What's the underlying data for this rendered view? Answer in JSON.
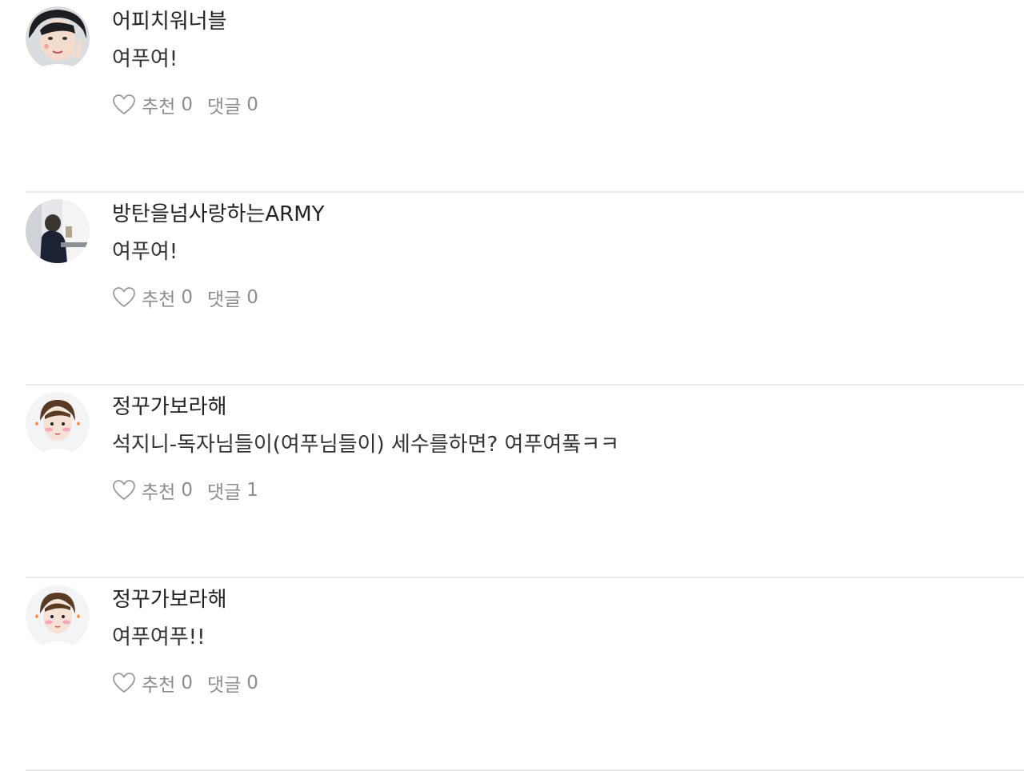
{
  "comments": [
    {
      "author": "어피치워너블",
      "text": "여푸여!",
      "like_label": "추천",
      "like_count": "0",
      "reply_label": "댓글",
      "reply_count": "0",
      "avatar": "face-peace-sign"
    },
    {
      "author": "방탄을넘사랑하는ARMY",
      "text": "여푸여!",
      "like_label": "추천",
      "like_count": "0",
      "reply_label": "댓글",
      "reply_count": "0",
      "avatar": "person-at-desk"
    },
    {
      "author": "정꾸가보라해",
      "text": "석지니-독자님들이(여푸님들이) 세수를하면? 여푸여풐ㅋㅋ",
      "like_label": "추천",
      "like_count": "0",
      "reply_label": "댓글",
      "reply_count": "1",
      "avatar": "blushing-face"
    },
    {
      "author": "정꾸가보라해",
      "text": "여푸여푸!!",
      "like_label": "추천",
      "like_count": "0",
      "reply_label": "댓글",
      "reply_count": "0",
      "avatar": "blushing-face"
    }
  ],
  "colors": {
    "meta_text": "#8c8c8c",
    "divider": "#ebebeb",
    "text": "#222222"
  }
}
